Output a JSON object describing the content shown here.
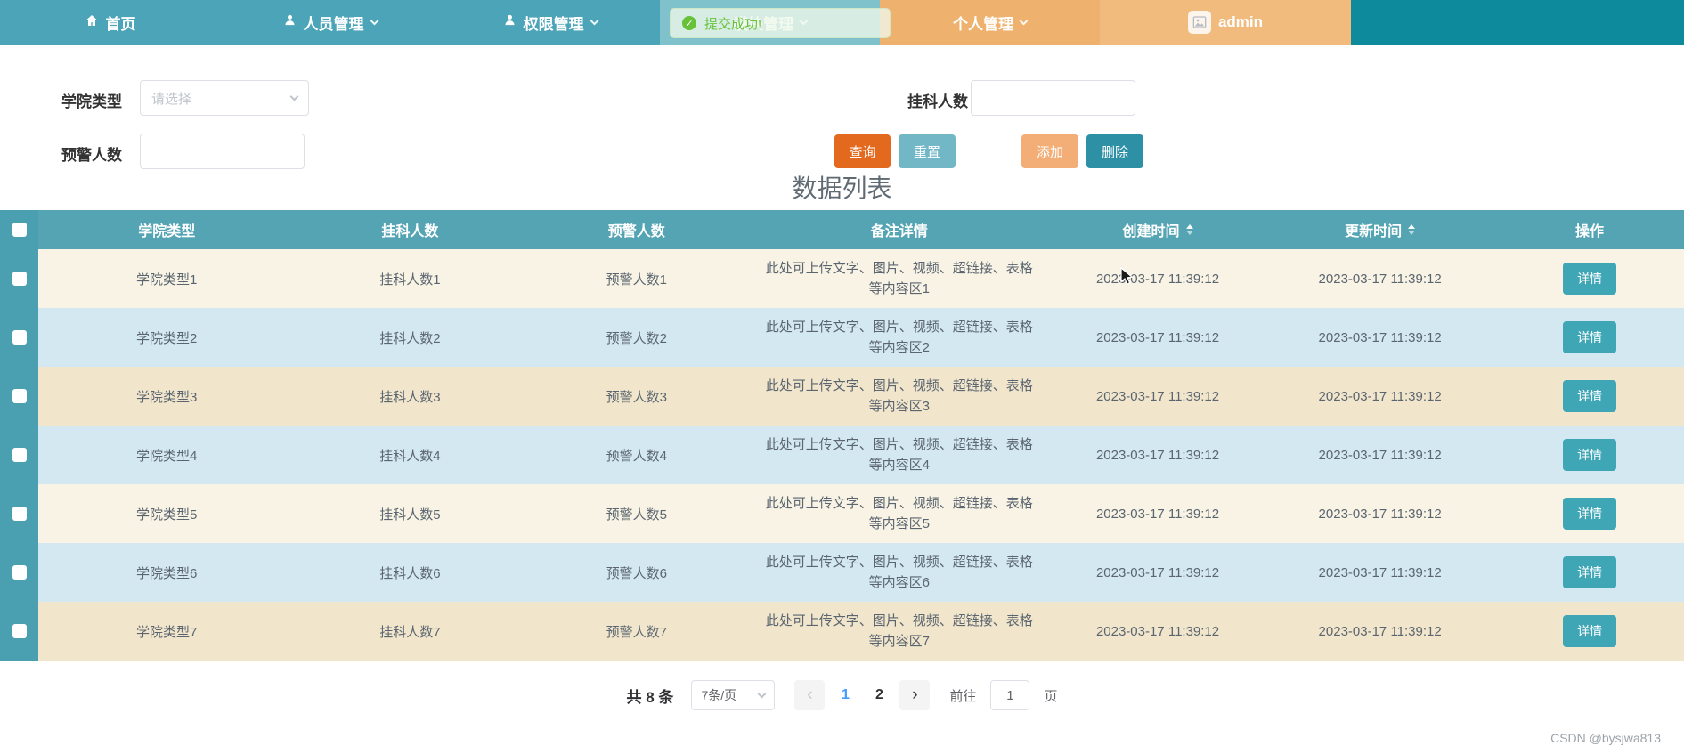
{
  "navbar": {
    "items": [
      {
        "label": "首页"
      },
      {
        "label": "人员管理"
      },
      {
        "label": "权限管理"
      },
      {
        "label": "模块管理"
      },
      {
        "label": "个人管理"
      },
      {
        "label": "admin"
      }
    ],
    "toast_text": "提交成功!"
  },
  "filters": {
    "college_type_label": "学院类型",
    "college_type_placeholder": "请选择",
    "fail_count_label": "挂科人数",
    "warning_count_label": "预警人数",
    "query_button": "查询",
    "reset_button": "重置",
    "add_button": "添加",
    "delete_button": "删除"
  },
  "list": {
    "title": "数据列表",
    "columns": [
      "学院类型",
      "挂科人数",
      "预警人数",
      "备注详情",
      "创建时间",
      "更新时间",
      "操作"
    ],
    "detail_button": "详情",
    "rows": [
      {
        "college_type": "学院类型1",
        "fail_count": "挂科人数1",
        "warning_count": "预警人数1",
        "note": "此处可上传文字、图片、视频、超链接、表格等内容区1",
        "created": "2023-03-17 11:39:12",
        "updated": "2023-03-17 11:39:12"
      },
      {
        "college_type": "学院类型2",
        "fail_count": "挂科人数2",
        "warning_count": "预警人数2",
        "note": "此处可上传文字、图片、视频、超链接、表格等内容区2",
        "created": "2023-03-17 11:39:12",
        "updated": "2023-03-17 11:39:12"
      },
      {
        "college_type": "学院类型3",
        "fail_count": "挂科人数3",
        "warning_count": "预警人数3",
        "note": "此处可上传文字、图片、视频、超链接、表格等内容区3",
        "created": "2023-03-17 11:39:12",
        "updated": "2023-03-17 11:39:12"
      },
      {
        "college_type": "学院类型4",
        "fail_count": "挂科人数4",
        "warning_count": "预警人数4",
        "note": "此处可上传文字、图片、视频、超链接、表格等内容区4",
        "created": "2023-03-17 11:39:12",
        "updated": "2023-03-17 11:39:12"
      },
      {
        "college_type": "学院类型5",
        "fail_count": "挂科人数5",
        "warning_count": "预警人数5",
        "note": "此处可上传文字、图片、视频、超链接、表格等内容区5",
        "created": "2023-03-17 11:39:12",
        "updated": "2023-03-17 11:39:12"
      },
      {
        "college_type": "学院类型6",
        "fail_count": "挂科人数6",
        "warning_count": "预警人数6",
        "note": "此处可上传文字、图片、视频、超链接、表格等内容区6",
        "created": "2023-03-17 11:39:12",
        "updated": "2023-03-17 11:39:12"
      },
      {
        "college_type": "学院类型7",
        "fail_count": "挂科人数7",
        "warning_count": "预警人数7",
        "note": "此处可上传文字、图片、视频、超链接、表格等内容区7",
        "created": "2023-03-17 11:39:12",
        "updated": "2023-03-17 11:39:12"
      }
    ]
  },
  "pagination": {
    "total_text": "共 8 条",
    "page_size_text": "7条/页",
    "pages": [
      "1",
      "2"
    ],
    "active_page": "1",
    "goto_label": "前往",
    "goto_value": "1",
    "goto_suffix": "页"
  },
  "watermark": "CSDN @bysjwa813",
  "colors": {
    "navbar_teal": "#4BA4B8",
    "navbar_module_teal": "#7FC2CC",
    "navbar_orange": "#EFB26E",
    "navbar_admin_orange": "#F1BB7E",
    "navbar_dark_teal": "#0D8A9C",
    "table_header_teal": "#54A4B4",
    "row_cream": "#F8F3E4",
    "row_blue": "#D3E8F1",
    "row_tan": "#F1E5CB",
    "query_orange": "#E2691D",
    "reset_teal": "#72B7C6",
    "add_orange": "#F2AE76",
    "delete_teal": "#2E90A5",
    "detail_teal": "#3FA6B6",
    "success_green": "#67C23A",
    "active_page_blue": "#409EFF"
  }
}
